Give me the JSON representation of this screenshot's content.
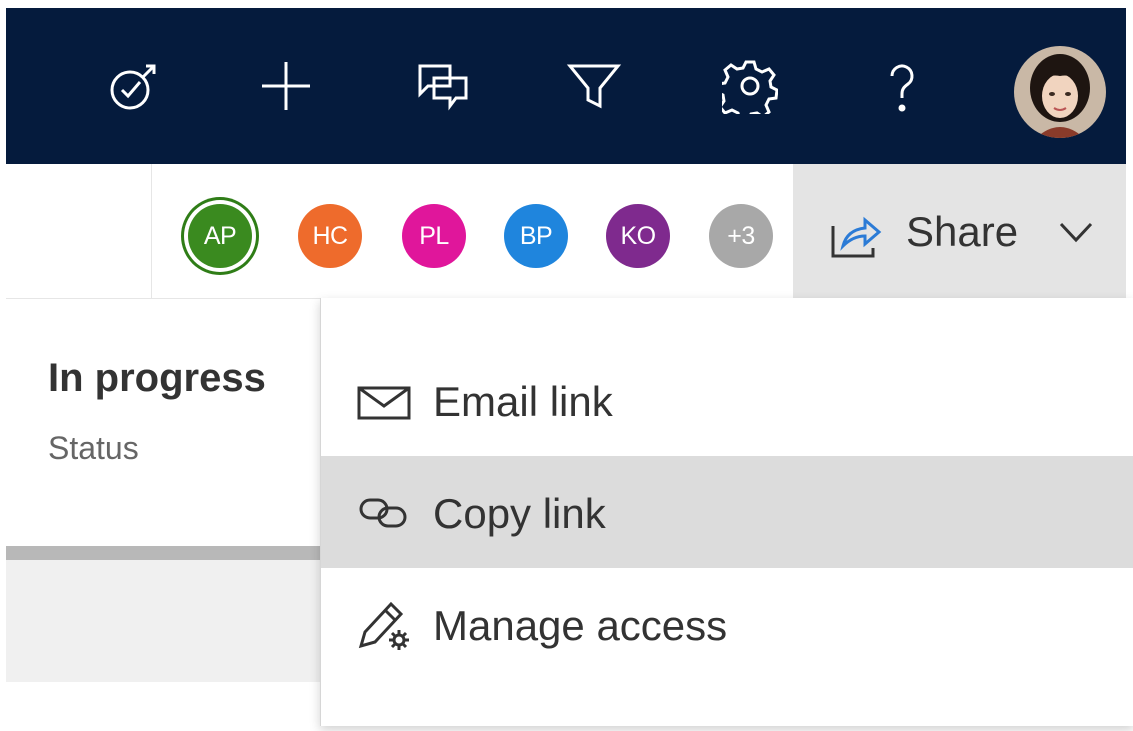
{
  "topbar": {
    "icons": [
      "focus-icon",
      "add-icon",
      "chat-icon",
      "filter-icon",
      "settings-icon",
      "help-icon"
    ],
    "background": "#051b3d"
  },
  "collaborators": [
    {
      "initials": "AP",
      "color": "#3a8a1f"
    },
    {
      "initials": "HC",
      "color": "#ee6b2c"
    },
    {
      "initials": "PL",
      "color": "#e0169b"
    },
    {
      "initials": "BP",
      "color": "#1f85dd"
    },
    {
      "initials": "KO",
      "color": "#7f2a8e"
    },
    {
      "initials": "+3",
      "color": "#a8a8a8"
    }
  ],
  "share": {
    "label": "Share"
  },
  "status": {
    "value": "In progress",
    "label": "Status"
  },
  "menu": {
    "items": [
      {
        "label": "Email link",
        "icon": "mail-icon"
      },
      {
        "label": "Copy link",
        "icon": "link-icon"
      },
      {
        "label": "Manage access",
        "icon": "edit-settings-icon"
      }
    ]
  }
}
